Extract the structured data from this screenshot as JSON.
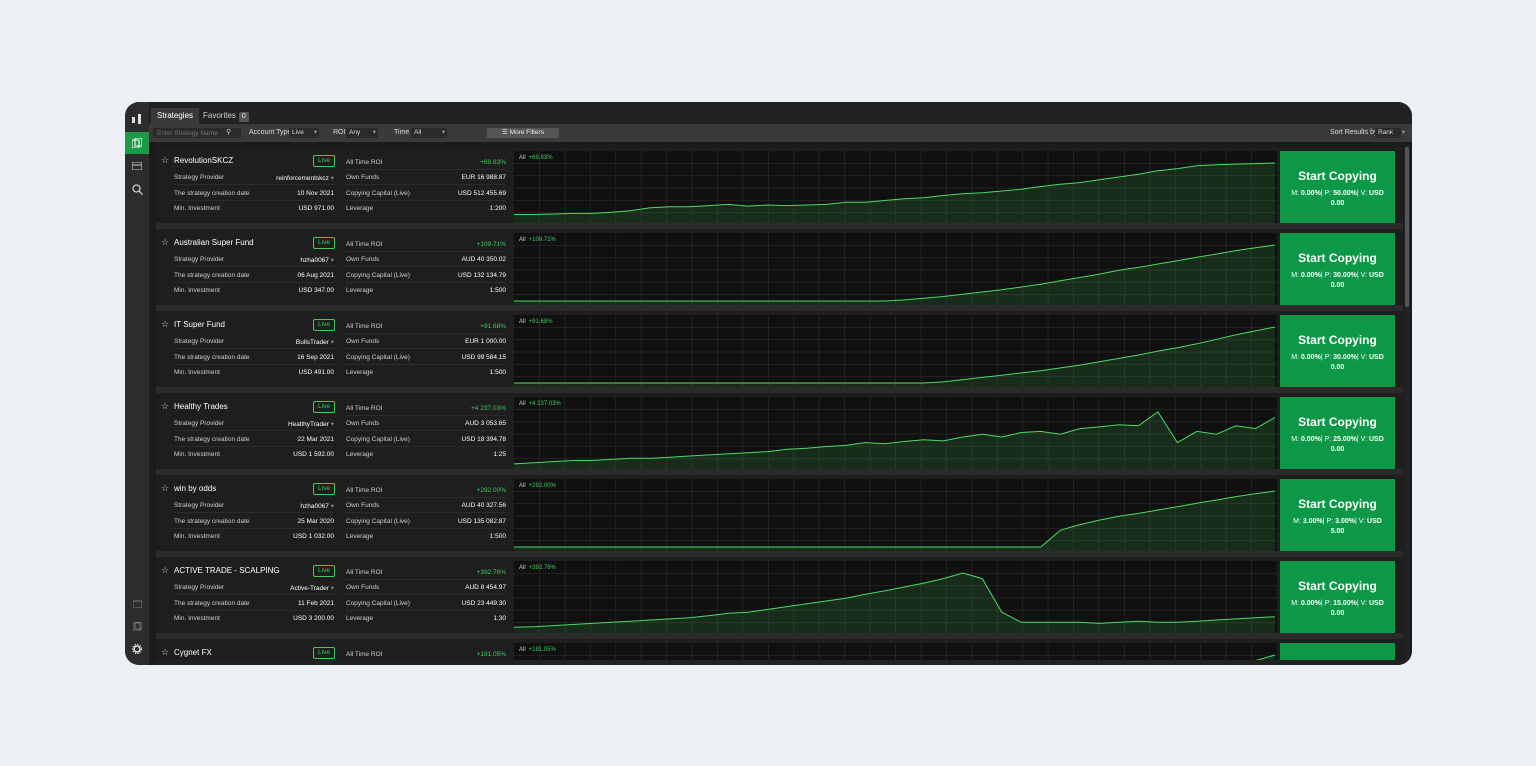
{
  "tabs": [
    {
      "label": "Strategies",
      "active": true
    },
    {
      "label": "Favorites",
      "count": "0",
      "active": false
    }
  ],
  "filters": {
    "search_placeholder": "Enter Strategy Name",
    "account_type_label": "Account Type",
    "account_type_value": "Live",
    "roi_label": "ROI",
    "roi_value": "Any",
    "time_label": "Time",
    "time_value": "All",
    "more_filters": "More Filters",
    "sort_label": "Sort Results by",
    "sort_value": "Rank"
  },
  "labels": {
    "provider": "Strategy Provider",
    "created": "The strategy creation date",
    "min_invest": "Min. Investment",
    "roi": "All Time ROI",
    "own_funds": "Own Funds",
    "copy_capital": "Copying Capital (Live)",
    "leverage": "Leverage",
    "live": "Live",
    "chart_period": "All",
    "start_copying": "Start Copying",
    "fee_m": "M:",
    "fee_p": "P:",
    "fee_v": "V:"
  },
  "strategies": [
    {
      "name": "RevolutionSKCZ",
      "provider": "reinforcementskcz",
      "created": "10 Nov 2021",
      "min": "USD 971.00",
      "roi": "+69.83%",
      "own": "EUR 16 988.87",
      "capital": "USD 512 455.69",
      "leverage": "1:200",
      "m": "0.00%",
      "p": "50.00%",
      "v": "USD 0.00",
      "curve": [
        0.08,
        0.08,
        0.09,
        0.1,
        0.1,
        0.12,
        0.15,
        0.2,
        0.22,
        0.22,
        0.24,
        0.26,
        0.23,
        0.25,
        0.24,
        0.25,
        0.26,
        0.3,
        0.3,
        0.33,
        0.36,
        0.38,
        0.42,
        0.45,
        0.47,
        0.5,
        0.53,
        0.58,
        0.62,
        0.65,
        0.7,
        0.75,
        0.8,
        0.86,
        0.9,
        0.95,
        0.97,
        0.98,
        0.99,
        1.0
      ]
    },
    {
      "name": "Australian Super Fund",
      "provider": "hzha0067",
      "created": "06 Aug 2021",
      "min": "USD 347.00",
      "roi": "+109.71%",
      "own": "AUD 40 350.02",
      "capital": "USD 132 134.79",
      "leverage": "1:500",
      "m": "0.00%",
      "p": "30.00%",
      "v": "USD 0.00",
      "curve": [
        0.0,
        0.0,
        0.0,
        0.0,
        0.0,
        0.0,
        0.0,
        0.0,
        0.0,
        0.0,
        0.0,
        0.0,
        0.0,
        0.0,
        0.0,
        0.0,
        0.0,
        0.0,
        0.0,
        0.0,
        0.02,
        0.05,
        0.08,
        0.12,
        0.16,
        0.2,
        0.25,
        0.3,
        0.36,
        0.42,
        0.48,
        0.55,
        0.6,
        0.66,
        0.72,
        0.78,
        0.84,
        0.9,
        0.95,
        1.0
      ]
    },
    {
      "name": "IT Super Fund",
      "provider": "BullsTrader",
      "created": "16 Sep 2021",
      "min": "USD 491.00",
      "roi": "+91.68%",
      "own": "EUR 1 000.00",
      "capital": "USD 99 584.15",
      "leverage": "1:500",
      "m": "0.00%",
      "p": "30.00%",
      "v": "USD 0.00",
      "curve": [
        0.0,
        0.0,
        0.0,
        0.0,
        0.0,
        0.0,
        0.0,
        0.0,
        0.0,
        0.0,
        0.0,
        0.0,
        0.0,
        0.0,
        0.0,
        0.0,
        0.0,
        0.0,
        0.0,
        0.0,
        0.0,
        0.0,
        0.02,
        0.06,
        0.1,
        0.14,
        0.18,
        0.22,
        0.27,
        0.32,
        0.38,
        0.44,
        0.5,
        0.57,
        0.63,
        0.7,
        0.78,
        0.86,
        0.93,
        1.0
      ]
    },
    {
      "name": "Healthy Trades",
      "provider": "HealthyTrader",
      "created": "22 Mar 2021",
      "min": "USD 1 592.00",
      "roi": "+4 237.03%",
      "own": "AUD 3 053.65",
      "capital": "USD 18 394.78",
      "leverage": "1:25",
      "m": "0.00%",
      "p": "25.00%",
      "v": "USD 0.00",
      "curve": [
        0.02,
        0.04,
        0.06,
        0.08,
        0.08,
        0.1,
        0.12,
        0.12,
        0.14,
        0.16,
        0.18,
        0.2,
        0.22,
        0.24,
        0.28,
        0.3,
        0.33,
        0.35,
        0.4,
        0.38,
        0.42,
        0.45,
        0.43,
        0.5,
        0.55,
        0.5,
        0.58,
        0.6,
        0.55,
        0.65,
        0.68,
        0.72,
        0.7,
        0.95,
        0.4,
        0.6,
        0.55,
        0.7,
        0.65,
        0.85
      ]
    },
    {
      "name": "win by odds",
      "provider": "hzha0067",
      "created": "25 Mar 2020",
      "min": "USD 1 032.00",
      "roi": "+292.00%",
      "own": "AUD 40 327.56",
      "capital": "USD 135 082.87",
      "leverage": "1:500",
      "m": "3.00%",
      "p": "3.00%",
      "v": "USD 5.00",
      "curve": [
        0.0,
        0.0,
        0.0,
        0.0,
        0.0,
        0.0,
        0.0,
        0.0,
        0.0,
        0.0,
        0.0,
        0.0,
        0.0,
        0.0,
        0.0,
        0.0,
        0.0,
        0.0,
        0.0,
        0.0,
        0.0,
        0.0,
        0.0,
        0.0,
        0.0,
        0.0,
        0.0,
        0.0,
        0.3,
        0.4,
        0.48,
        0.55,
        0.6,
        0.66,
        0.72,
        0.78,
        0.84,
        0.9,
        0.95,
        1.0
      ]
    },
    {
      "name": "ACTIVE TRADE - SCALPING",
      "provider": "Active-Trader",
      "created": "11 Feb 2021",
      "min": "USD 3 200.00",
      "roi": "+392.76%",
      "own": "AUD 8 454.97",
      "capital": "USD 23 449.30",
      "leverage": "1:30",
      "m": "0.00%",
      "p": "15.00%",
      "v": "USD 0.00",
      "curve": [
        0.03,
        0.04,
        0.06,
        0.08,
        0.1,
        0.12,
        0.14,
        0.16,
        0.18,
        0.2,
        0.24,
        0.28,
        0.3,
        0.35,
        0.4,
        0.45,
        0.5,
        0.55,
        0.62,
        0.68,
        0.75,
        0.82,
        0.9,
        1.0,
        0.9,
        0.3,
        0.12,
        0.12,
        0.12,
        0.12,
        0.1,
        0.12,
        0.14,
        0.12,
        0.12,
        0.14,
        0.16,
        0.18,
        0.2,
        0.22
      ]
    },
    {
      "name": "Cygnet FX",
      "provider": "",
      "created": "",
      "min": "",
      "roi": "+181.05%",
      "own": "",
      "capital": "",
      "leverage": "",
      "m": "",
      "p": "",
      "v": "",
      "curve": [
        0.0,
        0.0,
        0.0,
        0.0,
        0.0,
        0.0,
        0.0,
        0.0,
        0.0,
        0.0,
        0.0,
        0.0,
        0.0,
        0.0,
        0.0,
        0.0,
        0.0,
        0.0,
        0.0,
        0.0,
        0.0,
        0.0,
        0.0,
        0.0,
        0.0,
        0.0,
        0.0,
        0.0,
        0.0,
        0.0,
        0.0,
        0.0,
        0.0,
        0.3,
        0.45,
        0.6,
        0.72,
        0.82,
        0.9,
        1.0
      ]
    }
  ],
  "colors": {
    "accent": "#0c9847",
    "positive": "#3fcc5f",
    "line": "#4cd964"
  }
}
